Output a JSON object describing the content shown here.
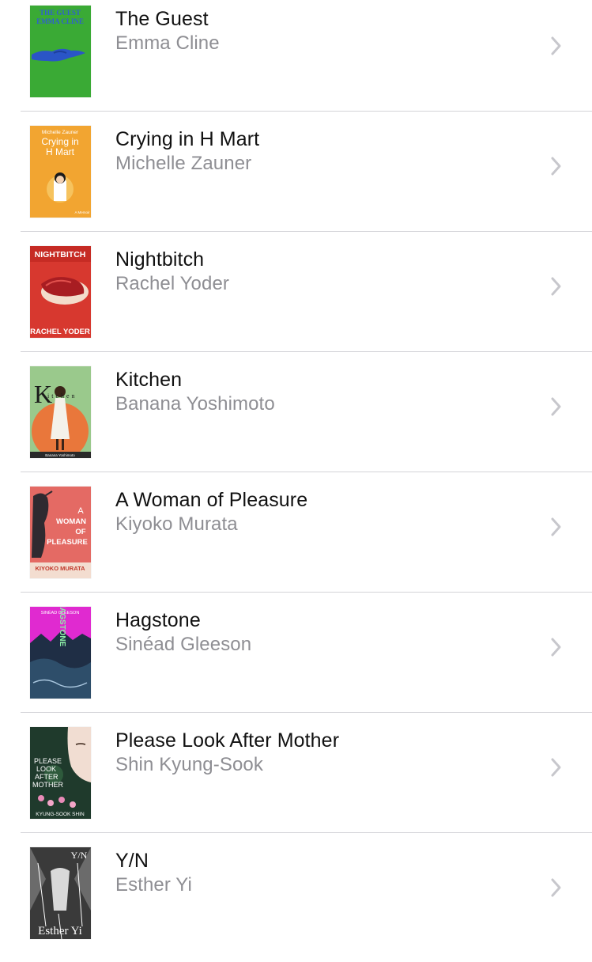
{
  "books": [
    {
      "title": "The Guest",
      "author": "Emma Cline",
      "cover": {
        "icon": "the-guest-cover",
        "bg": "#3aaa35",
        "lines": [
          "THE GUEST",
          "EMMA CLINE"
        ],
        "text_color": "#2f5fd0"
      }
    },
    {
      "title": "Crying in H Mart",
      "author": "Michelle Zauner",
      "cover": {
        "icon": "crying-in-h-mart-cover",
        "bg": "#f2a531",
        "lines": [
          "Michelle Zauner",
          "Crying in",
          "H Mart",
          "A Memoir"
        ],
        "text_color": "#ffffff"
      }
    },
    {
      "title": "Nightbitch",
      "author": "Rachel Yoder",
      "cover": {
        "icon": "nightbitch-cover",
        "bg": "#d7382f",
        "lines": [
          "NIGHTBITCH",
          "RACHEL YODER"
        ],
        "text_color": "#ffffff"
      }
    },
    {
      "title": "Kitchen",
      "author": "Banana Yoshimoto",
      "cover": {
        "icon": "kitchen-cover",
        "bg": "#9ac98c",
        "lines": [
          "K",
          "itchen",
          "Banana Yoshimoto"
        ],
        "text_color": "#1a1a1a"
      }
    },
    {
      "title": "A Woman of Pleasure",
      "author": "Kiyoko Murata",
      "cover": {
        "icon": "a-woman-of-pleasure-cover",
        "bg": "#e46a64",
        "lines": [
          "A",
          "WOMAN",
          "OF",
          "PLEASURE",
          "KIYOKO MURATA"
        ],
        "text_color": "#ffffff"
      }
    },
    {
      "title": "Hagstone",
      "author": "Sinéad Gleeson",
      "cover": {
        "icon": "hagstone-cover",
        "bg": "#e02ad0",
        "lines": [
          "SINÉAD GLEESON",
          "HAGSTONE"
        ],
        "text_color": "#8ef0a8"
      }
    },
    {
      "title": "Please Look After Mother",
      "author": "Shin Kyung-Sook",
      "cover": {
        "icon": "please-look-after-mother-cover",
        "bg": "#1f3a2c",
        "lines": [
          "PLEASE",
          "LOOK",
          "AFTER",
          "MOTHER",
          "KYUNG-SOOK SHIN"
        ],
        "text_color": "#ffffff"
      }
    },
    {
      "title": "Y/N",
      "author": "Esther Yi",
      "cover": {
        "icon": "y-n-cover",
        "bg": "#e9e9e9",
        "lines": [
          "Y/N",
          "Esther Yi"
        ],
        "text_color": "#ffffff"
      }
    }
  ],
  "chevron_icon": "chevron-right-icon",
  "colors": {
    "title": "#111111",
    "author": "#8e8e93",
    "separator": "#d4d4d8",
    "chevron": "#c7c7cc"
  }
}
